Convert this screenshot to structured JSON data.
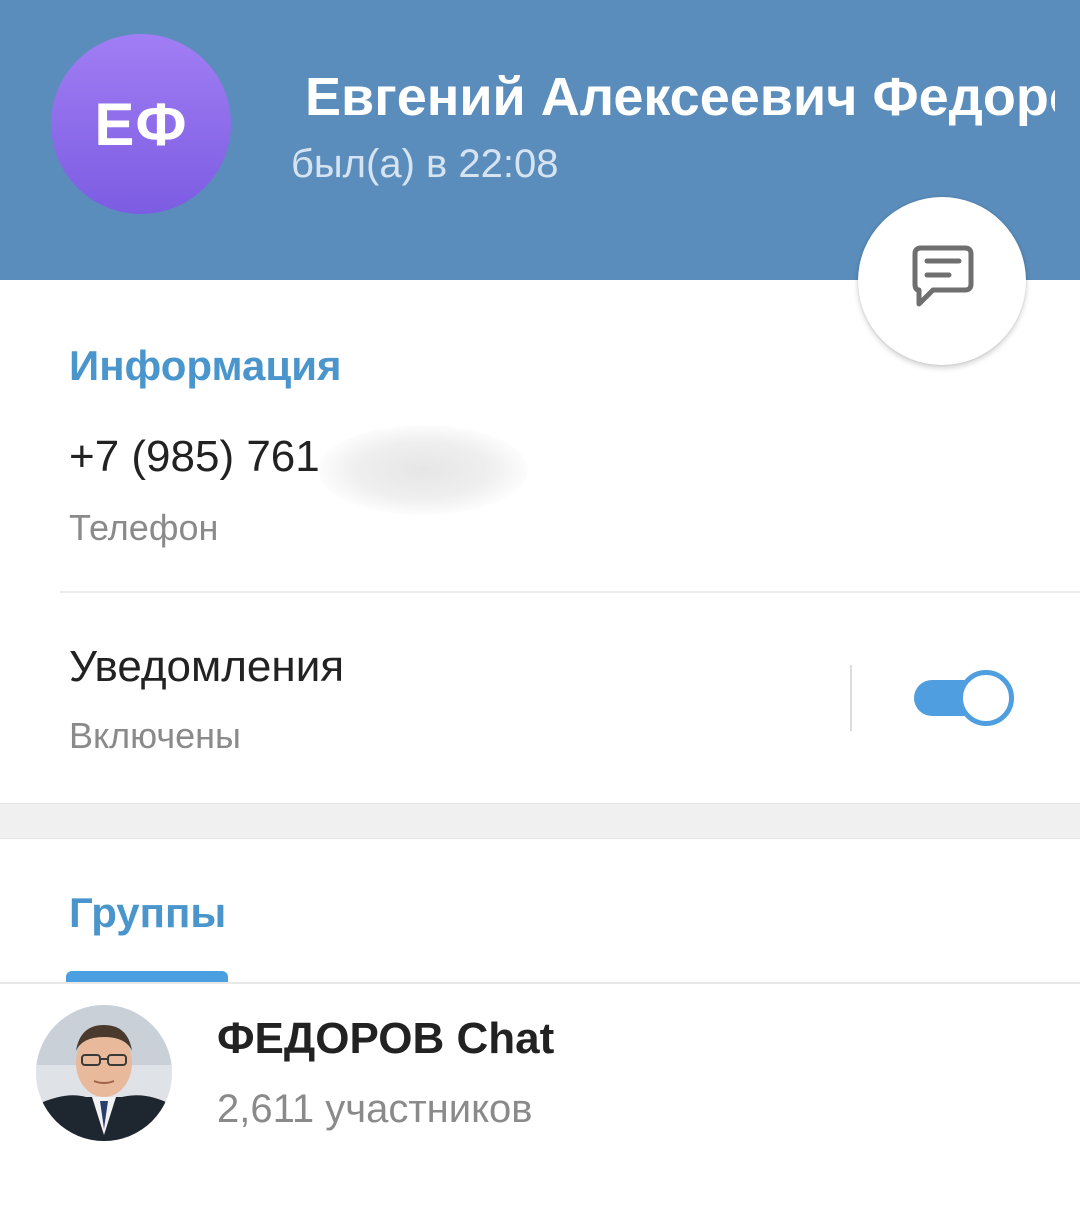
{
  "header": {
    "avatar_initials": "ЕФ",
    "contact_name": "Евгений Алексеевич Федоров",
    "last_seen": "был(а) в 22:08",
    "message_button_icon": "message-icon",
    "background_color": "#5a8dbb"
  },
  "info": {
    "section_title": "Информация",
    "phone_value": "+7 (985) 761",
    "phone_label": "Телефон",
    "notifications_title": "Уведомления",
    "notifications_status": "Включены",
    "notifications_enabled": true
  },
  "groups": {
    "section_title": "Группы",
    "items": [
      {
        "name": "ФЕДОРОВ Chat",
        "members": "2,611 участников"
      }
    ]
  },
  "colors": {
    "accent": "#4a95cb",
    "toggle": "#4e9ee0"
  }
}
